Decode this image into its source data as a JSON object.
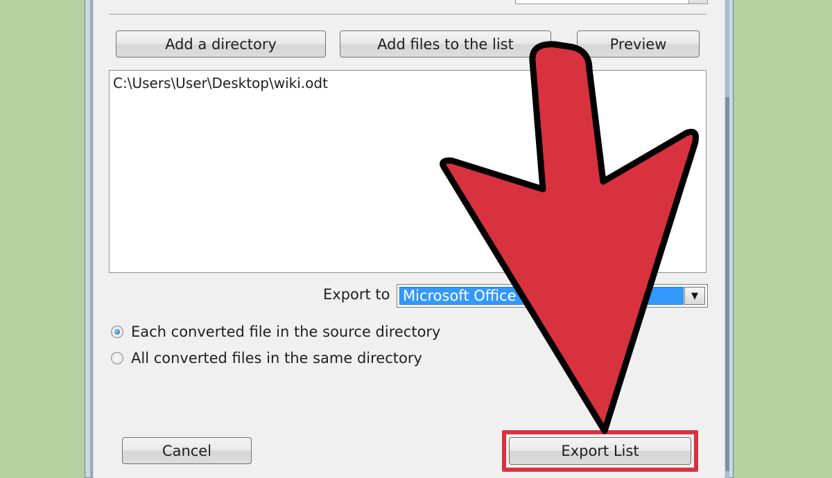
{
  "buttons": {
    "add_directory": "Add a directory",
    "add_files": "Add files to the list",
    "preview": "Preview",
    "cancel": "Cancel",
    "export_list": "Export List"
  },
  "file_list": {
    "items": [
      "C:\\Users\\User\\Desktop\\wiki.odt"
    ]
  },
  "export": {
    "label": "Export to",
    "selected_value": "Microsoft Office Word"
  },
  "output_options": {
    "each_in_source": "Each converted file in the source directory",
    "all_in_same": "All converted files in the same directory",
    "selected": "each_in_source"
  },
  "annotation": {
    "arrow_color": "#d8323f",
    "highlight_color": "#d8323f",
    "target": "Export List"
  }
}
